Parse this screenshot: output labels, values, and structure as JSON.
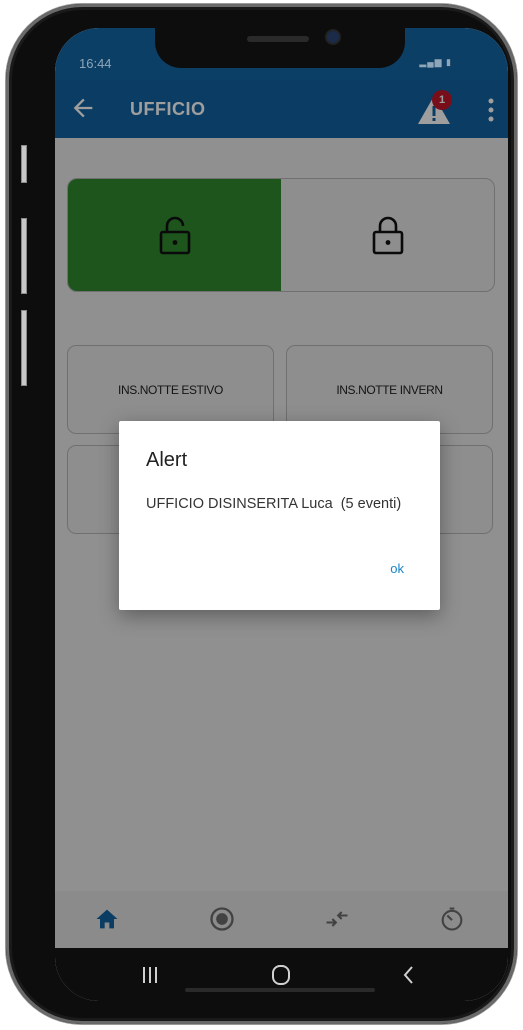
{
  "status": {
    "time": "16:44"
  },
  "appbar": {
    "title": "UFFICIO",
    "alert_count": "1"
  },
  "arm_buttons": [
    {
      "label": "INS.NOTTE ESTIVO"
    },
    {
      "label": "INS.NOTTE INVERN"
    }
  ],
  "dialog": {
    "title": "Alert",
    "message": "UFFICIO DISINSERITA Luca  (5 eventi)",
    "ok_label": "ok"
  },
  "icons": [
    "back-arrow-icon",
    "warning-icon",
    "more-vert-icon",
    "lock-open-icon",
    "lock-closed-icon",
    "home-icon",
    "radio-icon",
    "compare-arrows-icon",
    "timer-icon",
    "recents-icon",
    "home-circle-icon",
    "back-chevron-icon"
  ],
  "colors": {
    "appbar": "#1262a0",
    "disarmed": "#2f8a2f",
    "badge": "#c0172a",
    "ok": "#1a86c8"
  }
}
